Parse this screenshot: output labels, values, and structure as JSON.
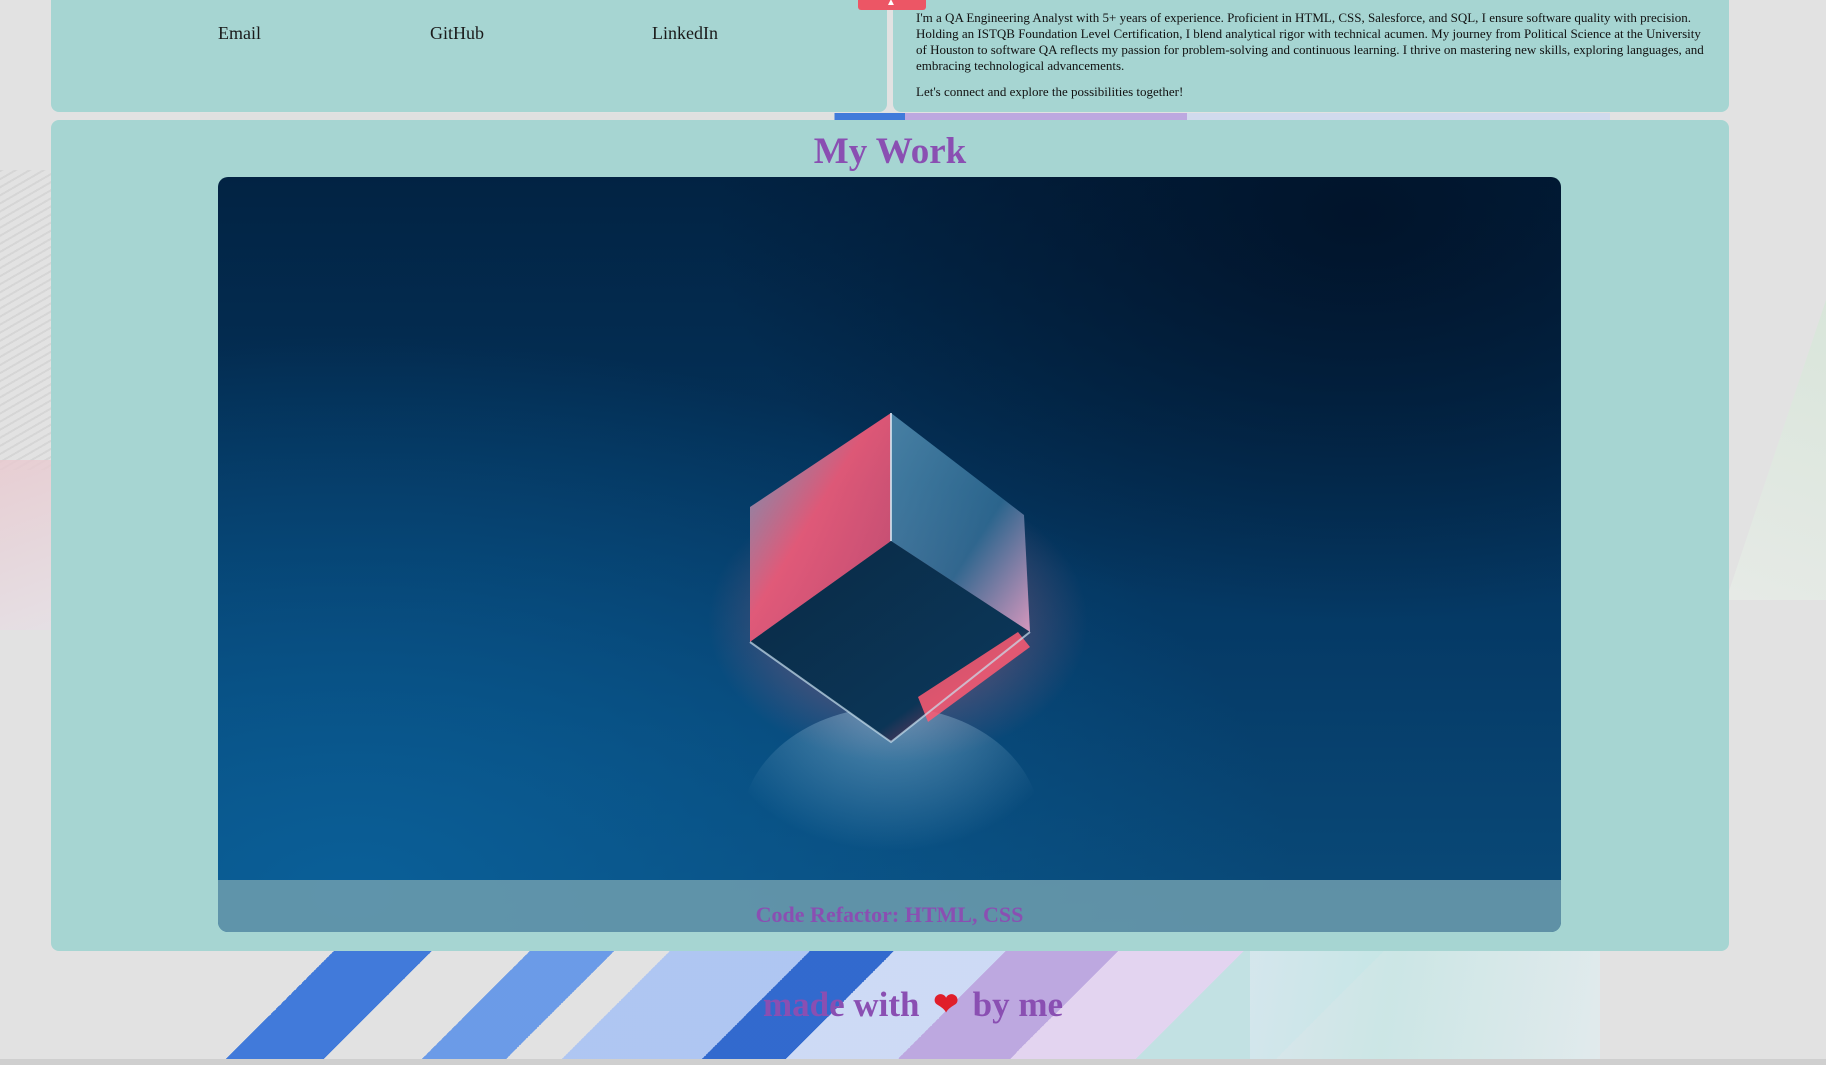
{
  "contact": {
    "links": [
      "Email",
      "GitHub",
      "LinkedIn"
    ]
  },
  "about": {
    "paragraphs": [
      "I'm a QA Engineering Analyst with 5+ years of experience. Proficient in HTML, CSS, Salesforce, and SQL, I ensure software quality with precision. Holding an ISTQB Foundation Level Certification, I blend analytical rigor with technical acumen. My journey from Political Science at the University of Houston to software QA reflects my passion for problem-solving and continuous learning. I thrive on mastering new skills, exploring languages, and embracing technological advancements.",
      "Let's connect and explore the possibilities together!"
    ]
  },
  "work": {
    "title": "My Work",
    "project_caption": "Code Refactor: HTML, CSS"
  },
  "footer": {
    "before": "made with",
    "heart": "❤",
    "after": "by me"
  },
  "colors": {
    "card_bg": "#a6d5d2",
    "accent_purple": "#8a4fb2",
    "ribbon_red": "#ec5665"
  }
}
